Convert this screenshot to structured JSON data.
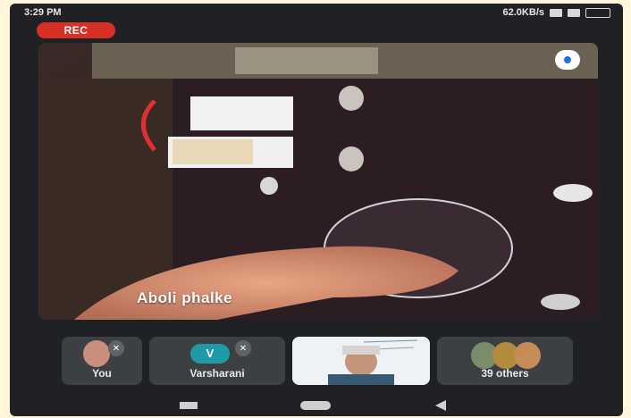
{
  "status_bar": {
    "time": "3:29 PM",
    "net_speed": "62.0KB/s",
    "icons": [
      "wifi-icon",
      "signal-icon",
      "battery-icon"
    ]
  },
  "recording": {
    "label": "REC",
    "color": "#d93025"
  },
  "main_video": {
    "speaker_name": "Aboli phalke",
    "pin_icon": "pin-icon"
  },
  "participants": [
    {
      "label": "You",
      "icon": "mic-off-icon"
    },
    {
      "label": "Varsharani",
      "avatar_letter": "V",
      "avatar_color": "#1e9aa8",
      "icon": "mic-off-icon"
    },
    {
      "label": "",
      "type": "video-tile"
    },
    {
      "label": "39 others"
    }
  ],
  "nav_bar": {
    "icons": [
      "recents-icon",
      "home-icon",
      "back-icon"
    ]
  }
}
